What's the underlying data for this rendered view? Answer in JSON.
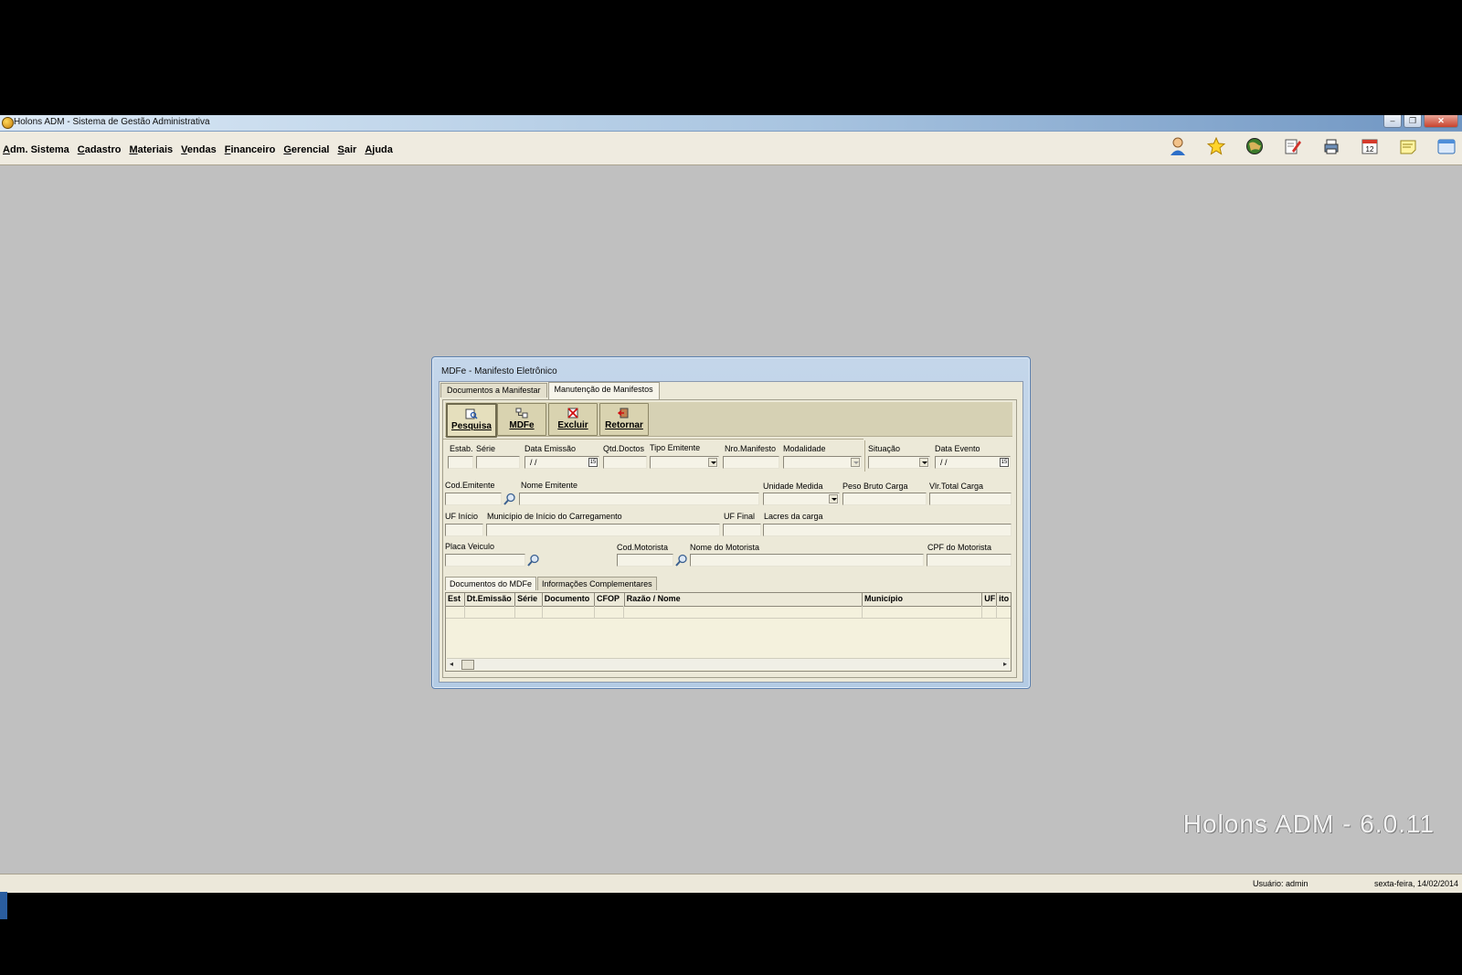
{
  "window": {
    "title": "Holons ADM - Sistema de Gestão Administrativa",
    "buttons": {
      "minimize": "–",
      "restore": "❐",
      "close": "✕"
    }
  },
  "menu": [
    "Adm. Sistema",
    "Cadastro",
    "Materiais",
    "Vendas",
    "Financeiro",
    "Gerencial",
    "Sair",
    "Ajuda"
  ],
  "toolbar_icons": [
    "user-icon",
    "star-icon",
    "globe-icon",
    "edit-icon",
    "print-icon",
    "calendar-icon",
    "xml-note-icon",
    "window-icon"
  ],
  "calendar_day": "12",
  "watermark": "Holons ADM - 6.0.11",
  "status": {
    "user": "Usuário: admin",
    "date": "sexta-feira, 14/02/2014"
  },
  "dialog": {
    "title": "MDFe - Manifesto Eletrônico",
    "outer_tabs": [
      "Documentos a Manifestar",
      "Manutenção de Manifestos"
    ],
    "actions": [
      "Pesquisa",
      "MDFe",
      "Excluir",
      "Retornar"
    ],
    "labels": {
      "estab": "Estab.",
      "serie": "Série",
      "data_emissao": "Data Emissão",
      "qtd_doctos": "Qtd.Doctos",
      "tipo_emitente": "Tipo Emitente",
      "nro_manifesto": "Nro.Manifesto",
      "modalidade": "Modalidade",
      "situacao": "Situação",
      "data_evento": "Data Evento",
      "cod_emitente": "Cod.Emitente",
      "nome_emitente": "Nome Emitente",
      "unidade_medida": "Unidade Medida",
      "peso_bruto": "Peso Bruto Carga",
      "vlr_total": "Vlr.Total Carga",
      "uf_inicio": "UF Início",
      "municipio_inicio": "Município de Início do Carregamento",
      "uf_final": "UF Final",
      "lacres": "Lacres da carga",
      "placa": "Placa Veiculo",
      "cod_motorista": "Cod.Motorista",
      "nome_motorista": "Nome do Motorista",
      "cpf_motorista": "CPF do Motorista"
    },
    "values": {
      "data_emissao": " / /",
      "data_evento": " / /"
    },
    "inner_tabs": [
      "Documentos do MDFe",
      "Informações Complementares"
    ],
    "grid_columns": [
      "Est",
      "Dt.Emissão",
      "Série",
      "Documento",
      "CFOP",
      "Razão / Nome",
      "Município",
      "UF",
      "ito"
    ]
  }
}
